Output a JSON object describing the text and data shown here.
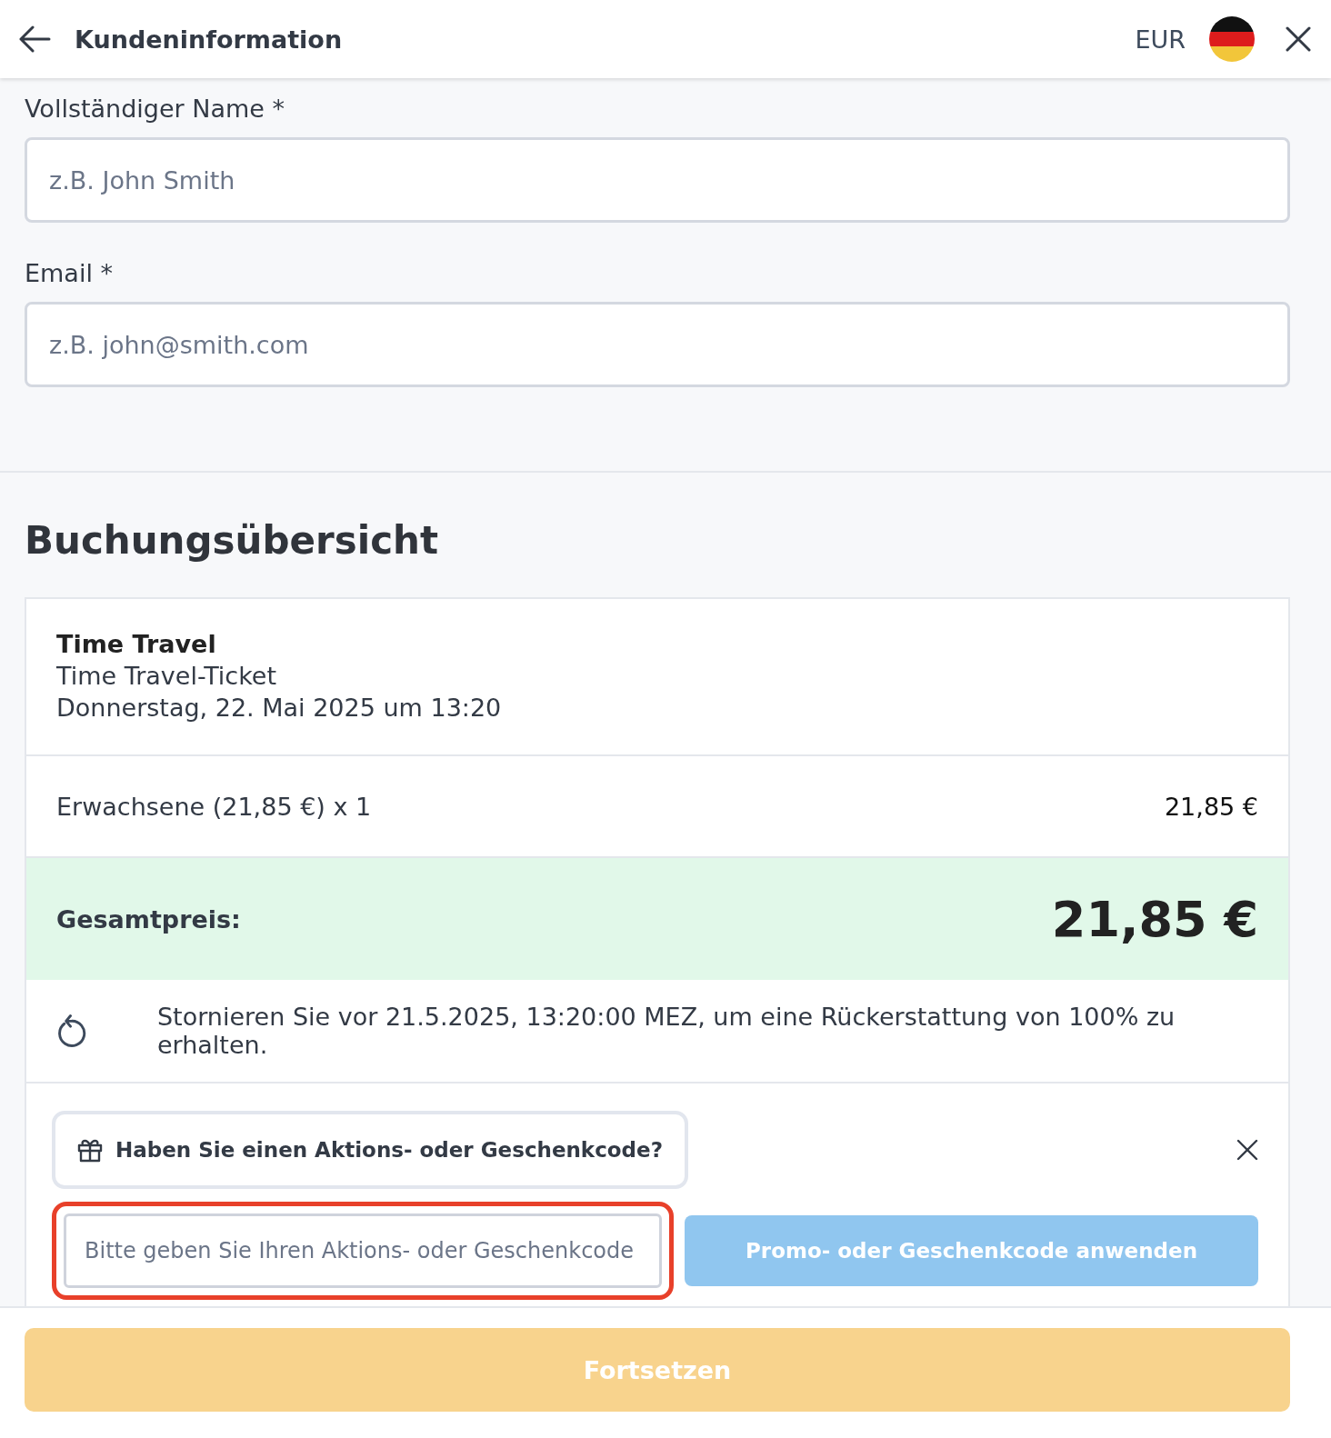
{
  "header": {
    "title": "Kundeninformation",
    "currency": "EUR"
  },
  "fields": [
    {
      "label": "Vollständiger Name *",
      "placeholder": "z.B. John Smith"
    },
    {
      "label": "Email *",
      "placeholder": "z.B. john@smith.com"
    }
  ],
  "summary": {
    "heading": "Buchungsübersicht",
    "product": {
      "name": "Time Travel",
      "ticket": "Time Travel-Ticket",
      "date": "Donnerstag, 22. Mai 2025 um 13:20"
    },
    "line_items": [
      {
        "label": "Erwachsene (21,85 €) x 1",
        "amount": "21,85 €"
      }
    ],
    "total": {
      "label": "Gesamtpreis:",
      "amount": "21,85 €"
    },
    "cancellation": "Stornieren Sie vor 21.5.2025, 13:20:00 MEZ, um eine Rückerstattung von 100% zu erhalten.",
    "promo": {
      "toggle": "Haben Sie einen Aktions- oder Geschenkcode?",
      "placeholder": "Bitte geben Sie Ihren Aktions- oder Geschenkcode",
      "highlighted": true,
      "apply": {
        "label": "Promo- oder Geschenkcode anwenden",
        "disabled": true
      }
    }
  },
  "continue": {
    "label": "Fortsetzen",
    "disabled": true
  }
}
